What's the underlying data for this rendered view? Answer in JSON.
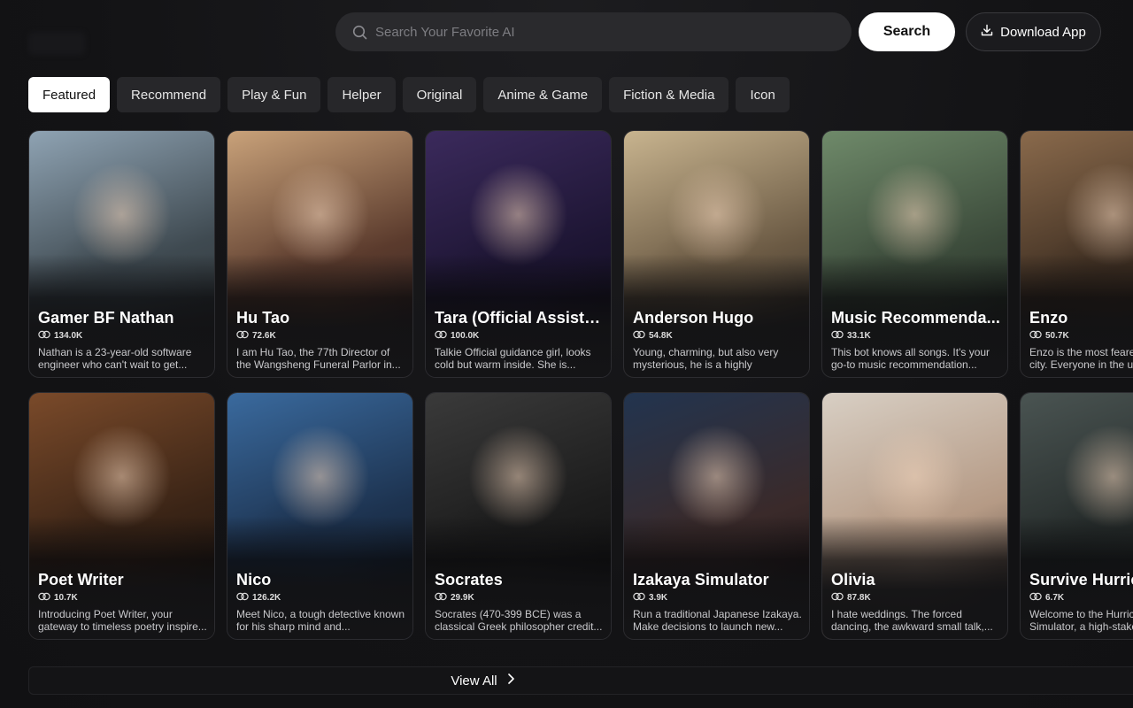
{
  "search": {
    "placeholder": "Search Your Favorite AI",
    "button_label": "Search"
  },
  "download": {
    "label": "Download App"
  },
  "tabs": [
    {
      "label": "Featured",
      "active": true
    },
    {
      "label": "Recommend",
      "active": false
    },
    {
      "label": "Play & Fun",
      "active": false
    },
    {
      "label": "Helper",
      "active": false
    },
    {
      "label": "Original",
      "active": false
    },
    {
      "label": "Anime & Game",
      "active": false
    },
    {
      "label": "Fiction & Media",
      "active": false
    },
    {
      "label": "Icon",
      "active": false
    }
  ],
  "cards": [
    {
      "name": "Gamer BF Nathan",
      "count": "134.0K",
      "desc": "Nathan is a 23-year-old software engineer who can't wait to get..."
    },
    {
      "name": "Hu Tao",
      "count": "72.6K",
      "desc": "I am Hu Tao, the 77th Director of the Wangsheng Funeral Parlor in..."
    },
    {
      "name": "Tara (Official Assista...",
      "count": "100.0K",
      "desc": "Talkie Official guidance girl, looks cold but warm inside. She is..."
    },
    {
      "name": "Anderson Hugo",
      "count": "54.8K",
      "desc": "Young, charming, but also very mysterious, he is a highly successf..."
    },
    {
      "name": "Music Recommenda...",
      "count": "33.1K",
      "desc": "This bot knows all songs. It's your go-to music recommendation..."
    },
    {
      "name": "Enzo",
      "count": "50.7K",
      "desc": "Enzo is the most feared man in the city. Everyone in the under..."
    },
    {
      "name": "Poet Writer",
      "count": "10.7K",
      "desc": "Introducing Poet Writer, your gateway to timeless poetry inspire..."
    },
    {
      "name": "Nico",
      "count": "126.2K",
      "desc": "Meet Nico, a tough detective known for his sharp mind and..."
    },
    {
      "name": "Socrates",
      "count": "29.9K",
      "desc": "Socrates (470-399 BCE) was a classical Greek philosopher credit..."
    },
    {
      "name": "Izakaya Simulator",
      "count": "3.9K",
      "desc": "Run a traditional Japanese Izakaya. Make decisions to launch new..."
    },
    {
      "name": "Olivia",
      "count": "87.8K",
      "desc": "I hate weddings. The forced dancing, the awkward small talk,..."
    },
    {
      "name": "Survive Hurricane",
      "count": "6.7K",
      "desc": "Welcome to the Hurricane Simulator, a high-stakes survival..."
    }
  ],
  "view_all": {
    "label": "View All"
  },
  "colors": {
    "background": "#141416",
    "tab_bg": "#27272a",
    "accent_white": "#ffffff"
  },
  "icons": {
    "search": "search-icon",
    "download": "download-icon",
    "chat_count": "chat-bubbles-icon",
    "chevron": "chevron-right-icon"
  }
}
